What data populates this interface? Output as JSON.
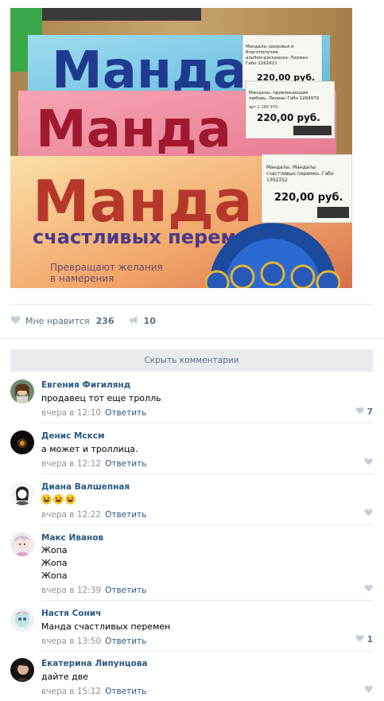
{
  "photo": {
    "book_title": "Манда",
    "book_subtitle": "счастливых перемен",
    "book_tagline_1": "Превращают желания",
    "book_tagline_2": "в намерения",
    "tags": [
      {
        "line1": "Мандалы здоровья и",
        "line2": "благополучия,",
        "line3": "альбом-раскраска. Лилиан",
        "line4": "Габо  1261621",
        "price": "220,00 руб."
      },
      {
        "line1": "Мандалы, привлекающие",
        "line2": "любовь. Лилиан Габо  1284979",
        "line3": "арт.1 284 979",
        "line4": "",
        "price": "220,00 руб."
      },
      {
        "line1": "Мандалы. Мандалы",
        "line2": "счастливых перемен. Габо",
        "line3": "1302352",
        "line4": "",
        "price": "220,00 руб."
      }
    ]
  },
  "actions": {
    "like_label": "Мне нравится",
    "like_count": "236",
    "share_count": "10"
  },
  "hide_comments_label": "Скрыть комментарии",
  "reply_label": "Ответить",
  "comments": [
    {
      "author": "Евгения Фигилянд",
      "text": "продавец тот еще тролль",
      "time": "вчера в 12:10",
      "likes": "7"
    },
    {
      "author": "Денис Мсксм",
      "text": "а может и троллица.",
      "time": "вчера в 12:12",
      "likes": ""
    },
    {
      "author": "Диана Валшепная",
      "text": "",
      "time": "вчера в 12:22",
      "likes": ""
    },
    {
      "author": "Макс Иванов",
      "lines": [
        "Жопа",
        "Жопа",
        "Жопа"
      ],
      "time": "вчера в 12:39",
      "likes": ""
    },
    {
      "author": "Настя Сонич",
      "text": "Манда счастливых перемен",
      "time": "вчера в 13:50",
      "likes": "1"
    },
    {
      "author": "Екатерина Липунцова",
      "text": "дайте две",
      "time": "вчера в 15:12",
      "likes": ""
    }
  ],
  "colors": {
    "link": "#2a5885",
    "meta": "#939393",
    "icon": "#c4cdd8",
    "button_bg": "#e9ebee"
  }
}
